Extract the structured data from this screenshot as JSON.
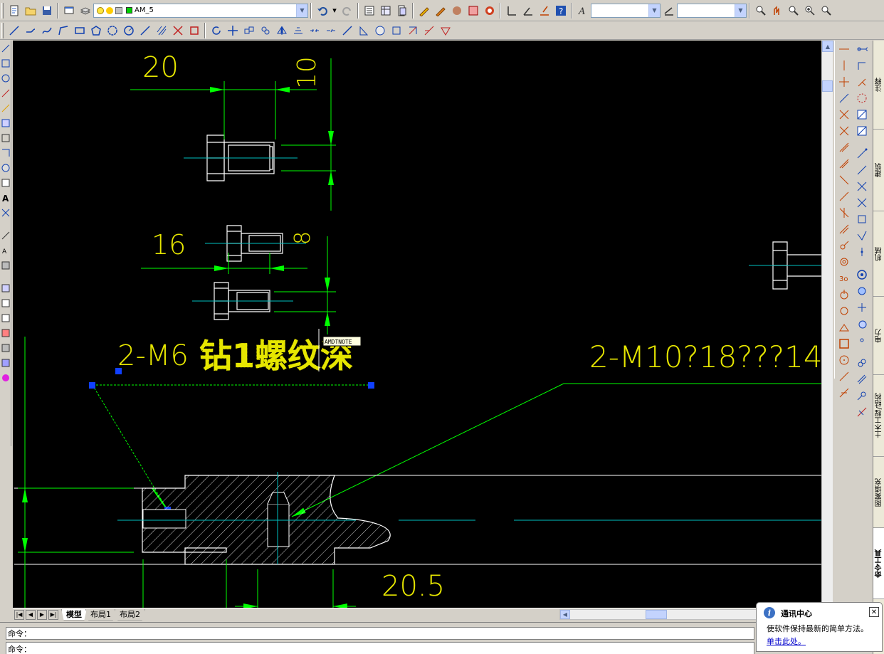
{
  "toolbar": {
    "layer_combo": "AM_5",
    "textstyle_combo": "",
    "dimstyle_combo": ""
  },
  "drawing": {
    "dim_20": "20",
    "dim_10": "10",
    "dim_16": "16",
    "dim_8": "8",
    "dim_20_5": "20.5",
    "note_m6_prefix": "2-M6",
    "note_m6_cn": "钻1螺纹深",
    "note_m10": "2-M10?18???14",
    "tooltip": "AMDTNOTE",
    "colors": {
      "dimension": "#00ff00",
      "text": "#e6e600",
      "geometry": "#ffffff",
      "center": "#00c0c0",
      "grip": "#1040ff"
    }
  },
  "layout_tabs": [
    "模型",
    "布局1",
    "布局2"
  ],
  "palette_tabs": [
    "注释",
    "建筑",
    "机械",
    "电力",
    "土木工程/结构",
    "图案填充",
    "命令工具"
  ],
  "command": {
    "line1": "命令：",
    "line2": "命令："
  },
  "notification": {
    "title": "通讯中心",
    "message": "使软件保持最新的简单方法。",
    "link": "单击此处。"
  }
}
